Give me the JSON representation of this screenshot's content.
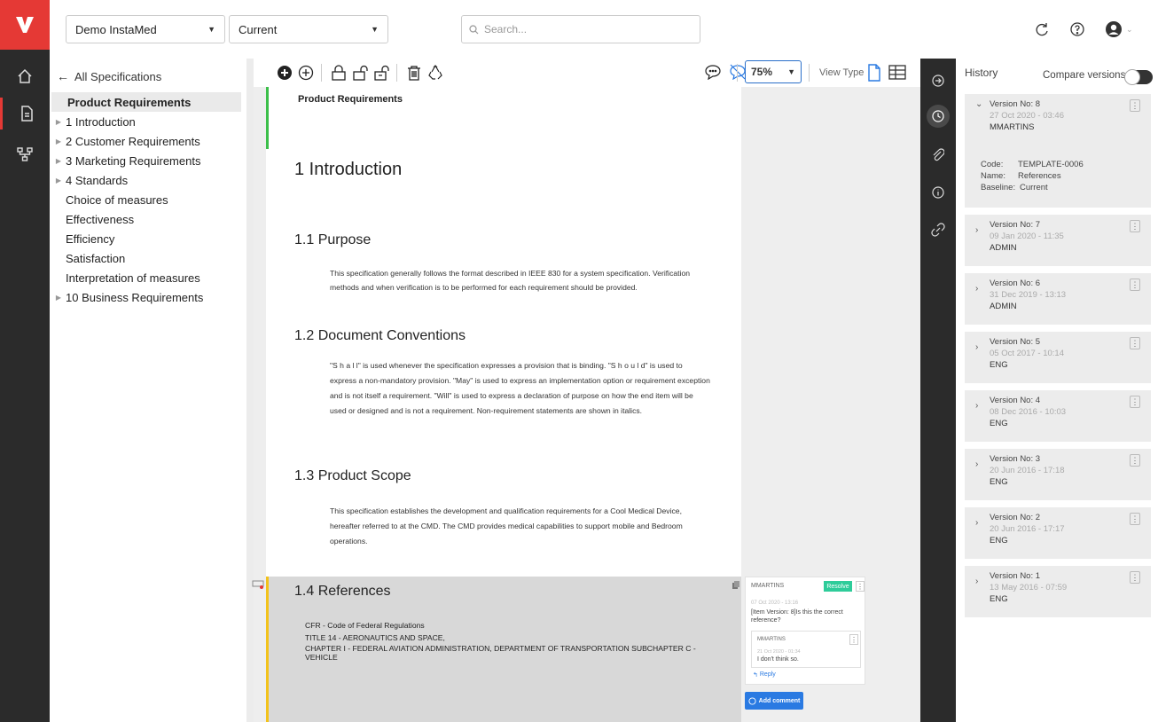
{
  "topbar": {
    "project_select": "Demo InstaMed",
    "baseline_select": "Current",
    "search_placeholder": "Search..."
  },
  "tree": {
    "back_label": "All Specifications",
    "items": [
      {
        "label": "Product Requirements",
        "has_children": false
      },
      {
        "label": "1  Introduction",
        "has_children": true
      },
      {
        "label": "2  Customer Requirements",
        "has_children": true
      },
      {
        "label": "3  Marketing Requirements",
        "has_children": true
      },
      {
        "label": "4  Standards",
        "has_children": true
      },
      {
        "label": "Choice of measures",
        "has_children": false
      },
      {
        "label": "Effectiveness",
        "has_children": false
      },
      {
        "label": "Efficiency",
        "has_children": false
      },
      {
        "label": "Satisfaction",
        "has_children": false
      },
      {
        "label": "Interpretation of measures",
        "has_children": false
      },
      {
        "label": "10  Business Requirements",
        "has_children": true
      }
    ]
  },
  "toolbar": {
    "zoom": "75%",
    "view_type_label": "View Type"
  },
  "document": {
    "title": "Product Requirements",
    "h_intro": "1  Introduction",
    "h_purpose": "1.1  Purpose",
    "purpose_text": "This specification generally follows the format described in IEEE 830 for a system specification. Verification methods and when verification is to be performed for each requirement should be provided.",
    "h_conventions": "1.2  Document Conventions",
    "conventions_text": "\"S h a l l\" is used whenever the specification expresses a provision that is binding. \"S h o u l d\" is used to express a non-mandatory provision. \"May\" is used to express an implementation option or requirement exception and is not itself a requirement. \"Will\" is used to express a declaration of purpose on how the end item will be used or designed and is not a requirement. Non-requirement statements are shown in italics.",
    "h_scope": "1.3  Product Scope",
    "scope_text": "This specification establishes the development and qualification requirements for a Cool Medical Device, hereafter referred to at the CMD. The CMD provides medical capabilities to support mobile and Bedroom operations.",
    "h_refs": "1.4  References",
    "refs_line1": "CFR - Code of Federal Regulations",
    "refs_line2": "TITLE 14 - AERONAUTICS AND SPACE,",
    "refs_line3": "CHAPTER I - FEDERAL AVIATION ADMINISTRATION, DEPARTMENT OF TRANSPORTATION SUBCHAPTER C - VEHICLE"
  },
  "comment": {
    "author": "MMARTINS",
    "resolve_label": "Resolve",
    "date": "07 Oct 2020 - 13:16",
    "text": "[Item Version: 8]Is this the correct reference?",
    "reply_author": "MMARTINS",
    "reply_date": "21 Oct 2020 - 01:34",
    "reply_text": "I don't think so.",
    "reply_label": "Reply",
    "add_comment_label": "Add comment"
  },
  "history": {
    "title": "History",
    "compare_label": "Compare versions",
    "expanded": {
      "version": "Version No: 8",
      "date": "27 Oct 2020 - 03:46",
      "user": "MMARTINS",
      "code_label": "Code:",
      "code": "TEMPLATE-0006",
      "name_label": "Name:",
      "name": "References",
      "baseline_label": "Baseline:",
      "baseline": "Current"
    },
    "versions": [
      {
        "version": "Version No: 7",
        "date": "09 Jan 2020 - 11:35",
        "user": "ADMIN"
      },
      {
        "version": "Version No: 6",
        "date": "31 Dec 2019 - 13:13",
        "user": "ADMIN"
      },
      {
        "version": "Version No: 5",
        "date": "05 Oct 2017 - 10:14",
        "user": "ENG"
      },
      {
        "version": "Version No: 4",
        "date": "08 Dec 2016 - 10:03",
        "user": "ENG"
      },
      {
        "version": "Version No: 3",
        "date": "20 Jun 2016 - 17:18",
        "user": "ENG"
      },
      {
        "version": "Version No: 2",
        "date": "20 Jun 2016 - 17:17",
        "user": "ENG"
      },
      {
        "version": "Version No: 1",
        "date": "13 May 2016 - 07:59",
        "user": "ENG"
      }
    ]
  }
}
